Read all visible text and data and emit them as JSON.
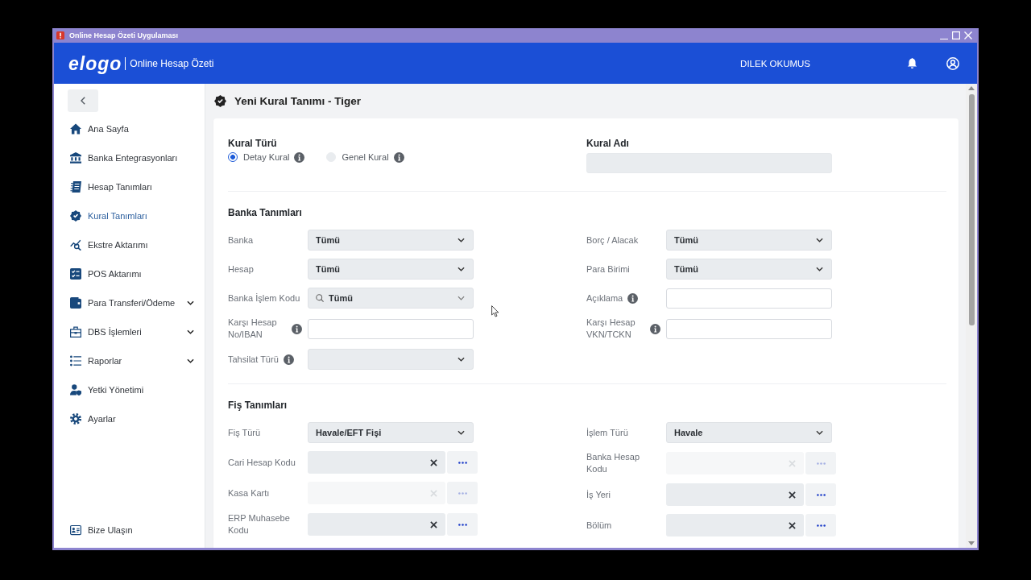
{
  "window": {
    "title": "Online Hesap Özeti Uygulaması"
  },
  "header": {
    "logo": "elogo",
    "app_name": "Online Hesap Özeti",
    "user_name": "DILEK OKUMUS"
  },
  "sidebar": {
    "items": [
      {
        "label": "Ana Sayfa",
        "kind": "link",
        "selected": false
      },
      {
        "label": "Banka Entegrasyonları",
        "kind": "link",
        "selected": false
      },
      {
        "label": "Hesap Tanımları",
        "kind": "link",
        "selected": false
      },
      {
        "label": "Kural Tanımları",
        "kind": "link",
        "selected": true
      },
      {
        "label": "Ekstre Aktarımı",
        "kind": "link",
        "selected": false
      },
      {
        "label": "POS Aktarımı",
        "kind": "link",
        "selected": false
      },
      {
        "label": "Para Transferi/Ödeme",
        "kind": "group",
        "selected": false
      },
      {
        "label": "DBS İşlemleri",
        "kind": "group",
        "selected": false
      },
      {
        "label": "Raporlar",
        "kind": "group",
        "selected": false
      },
      {
        "label": "Yetki Yönetimi",
        "kind": "link",
        "selected": false
      },
      {
        "label": "Ayarlar",
        "kind": "link",
        "selected": false
      }
    ],
    "footer_item": {
      "label": "Bize Ulaşın"
    }
  },
  "page": {
    "title": "Yeni Kural Tanımı - Tiger"
  },
  "form": {
    "rule_type": {
      "label": "Kural Türü",
      "options": [
        {
          "label": "Detay Kural",
          "selected": true,
          "info": true
        },
        {
          "label": "Genel Kural",
          "selected": false,
          "info": true
        }
      ]
    },
    "rule_name": {
      "label": "Kural Adı"
    },
    "sections": [
      {
        "title": "Banka Tanımları",
        "columns": [
          {
            "fields": [
              {
                "label": "Banka",
                "kind": "select",
                "value": "Tümü",
                "info": false,
                "disabled": false
              },
              {
                "label": "Hesap",
                "kind": "select",
                "value": "Tümü",
                "info": false,
                "disabled": false
              },
              {
                "label": "Banka İşlem Kodu",
                "kind": "search-select",
                "value": "Tümü",
                "info": false,
                "disabled": false
              },
              {
                "label": "Karşı Hesap No/IBAN",
                "kind": "text",
                "info": true,
                "disabled": false
              },
              {
                "label": "Tahsilat Türü",
                "kind": "select",
                "info": true,
                "disabled": false
              }
            ]
          },
          {
            "fields": [
              {
                "label": "Borç / Alacak",
                "kind": "select",
                "value": "Tümü",
                "info": false,
                "disabled": false
              },
              {
                "label": "Para Birimi",
                "kind": "select",
                "value": "Tümü",
                "info": false,
                "disabled": false
              },
              {
                "label": "Açıklama",
                "kind": "text",
                "info": true,
                "disabled": false
              },
              {
                "label": "Karşı Hesap VKN/TCKN",
                "kind": "text",
                "info": true,
                "disabled": false
              }
            ]
          }
        ]
      },
      {
        "title": "Fiş Tanımları",
        "columns": [
          {
            "fields": [
              {
                "label": "Fiş Türü",
                "kind": "select",
                "value": "Havale/EFT Fişi",
                "info": false,
                "disabled": false
              },
              {
                "label": "Cari Hesap Kodu",
                "kind": "lookup",
                "info": false,
                "disabled": false
              },
              {
                "label": "Kasa Kartı",
                "kind": "lookup",
                "info": false,
                "disabled": true
              },
              {
                "label": "ERP Muhasebe Kodu",
                "kind": "lookup",
                "info": false,
                "disabled": false
              }
            ]
          },
          {
            "fields": [
              {
                "label": "İşlem Türü",
                "kind": "select",
                "value": "Havale",
                "info": false,
                "disabled": false
              },
              {
                "label": "Banka Hesap Kodu",
                "kind": "lookup",
                "info": false,
                "disabled": true
              },
              {
                "label": "İş Yeri",
                "kind": "lookup",
                "info": false,
                "disabled": false
              },
              {
                "label": "Bölüm",
                "kind": "lookup",
                "info": false,
                "disabled": false
              }
            ]
          }
        ]
      }
    ]
  }
}
